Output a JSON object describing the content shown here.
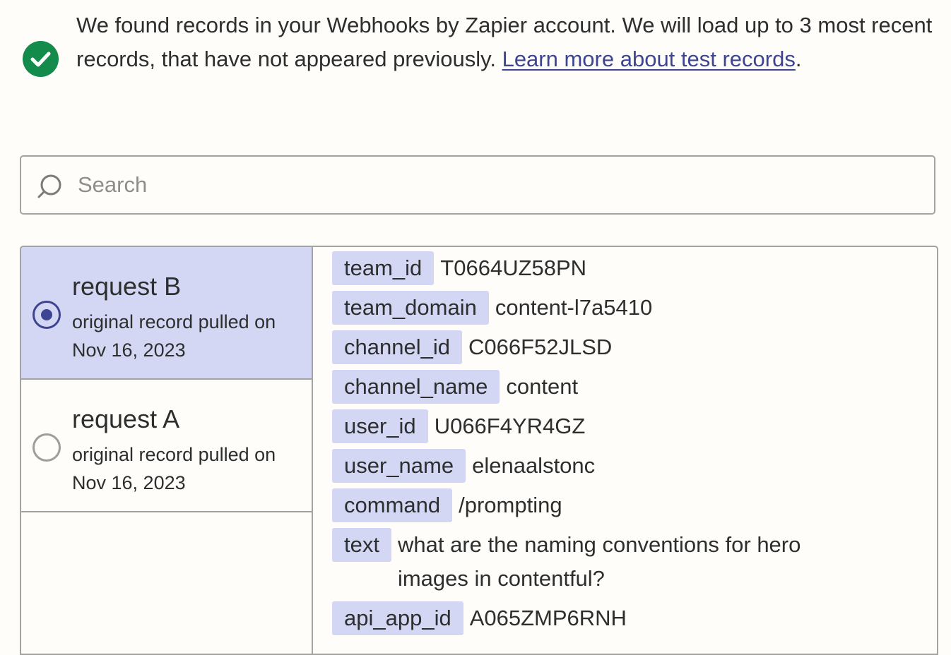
{
  "banner": {
    "icon": "check-circle-icon",
    "message": "We found records in your Webhooks by Zapier account. We will load up to 3 most recent records, that have not appeared previously.",
    "link_text": "Learn more about test records",
    "suffix": "."
  },
  "search": {
    "placeholder": "Search",
    "icon": "search-icon"
  },
  "records": [
    {
      "title": "request B",
      "subtitle": "original record pulled on Nov 16, 2023",
      "selected": true
    },
    {
      "title": "request A",
      "subtitle": "original record pulled on Nov 16, 2023",
      "selected": false
    }
  ],
  "fields": [
    {
      "key": "team_id",
      "value": "T0664UZ58PN"
    },
    {
      "key": "team_domain",
      "value": "content-l7a5410"
    },
    {
      "key": "channel_id",
      "value": "C066F52JLSD"
    },
    {
      "key": "channel_name",
      "value": "content"
    },
    {
      "key": "user_id",
      "value": "U066F4YR4GZ"
    },
    {
      "key": "user_name",
      "value": "elenaalstonc"
    },
    {
      "key": "command",
      "value": "/prompting"
    },
    {
      "key": "text",
      "value": "what are the naming conventions for hero images in contentful?"
    },
    {
      "key": "api_app_id",
      "value": "A065ZMP6RNH"
    }
  ],
  "colors": {
    "accent": "#3d4592",
    "selected_bg": "#d4d7f4",
    "success": "#138b4a"
  }
}
